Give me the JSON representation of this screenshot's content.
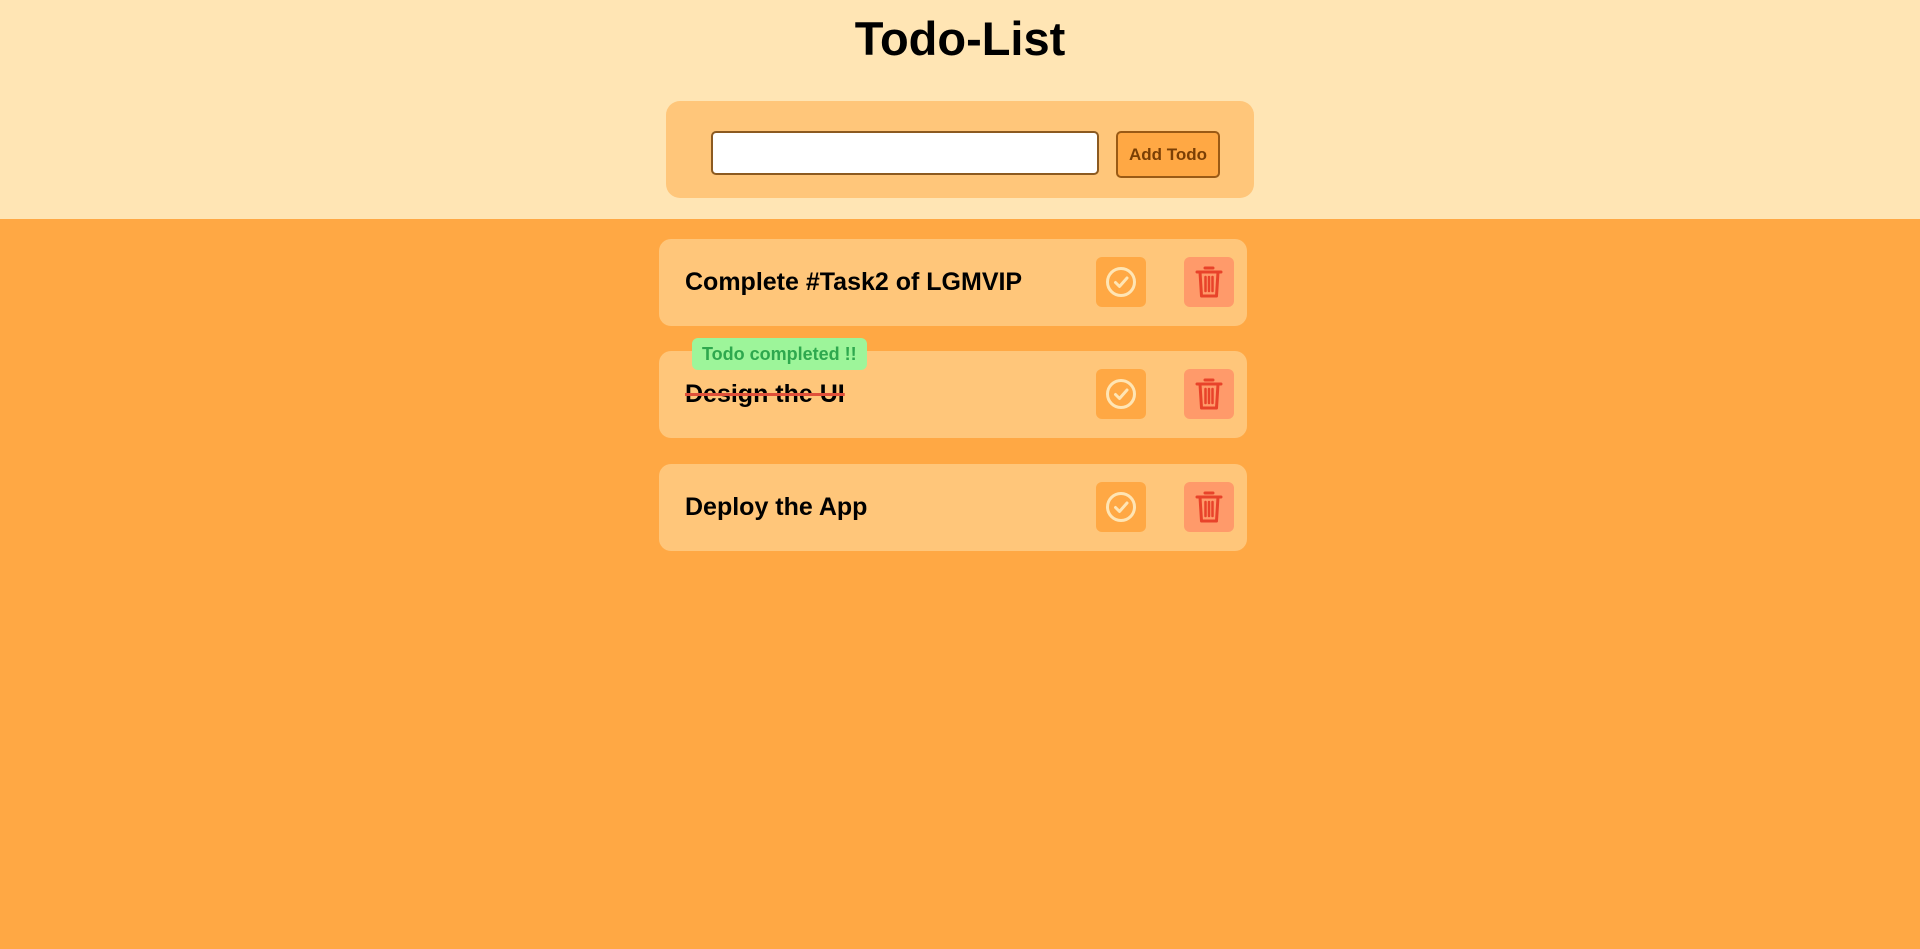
{
  "header": {
    "title": "Todo-List"
  },
  "form": {
    "input_value": "",
    "input_placeholder": "",
    "add_label": "Add Todo"
  },
  "todos": [
    {
      "text": "Complete #Task2 of LGMVIP",
      "completed": false
    },
    {
      "text": "Design the UI",
      "completed": true
    },
    {
      "text": "Deploy the App",
      "completed": false
    }
  ],
  "toast": {
    "message": "Todo completed !!"
  },
  "icons": {
    "complete": "check-circle-icon",
    "delete": "trash-icon"
  },
  "colors": {
    "header_bg": "#FFE5B4",
    "page_bg": "#FFA844",
    "card_bg": "#FFC67A",
    "delete_bg": "#FF9A6A",
    "trash_color": "#E8432A",
    "toast_bg": "#9DF59A",
    "toast_text": "#2EA84E"
  }
}
